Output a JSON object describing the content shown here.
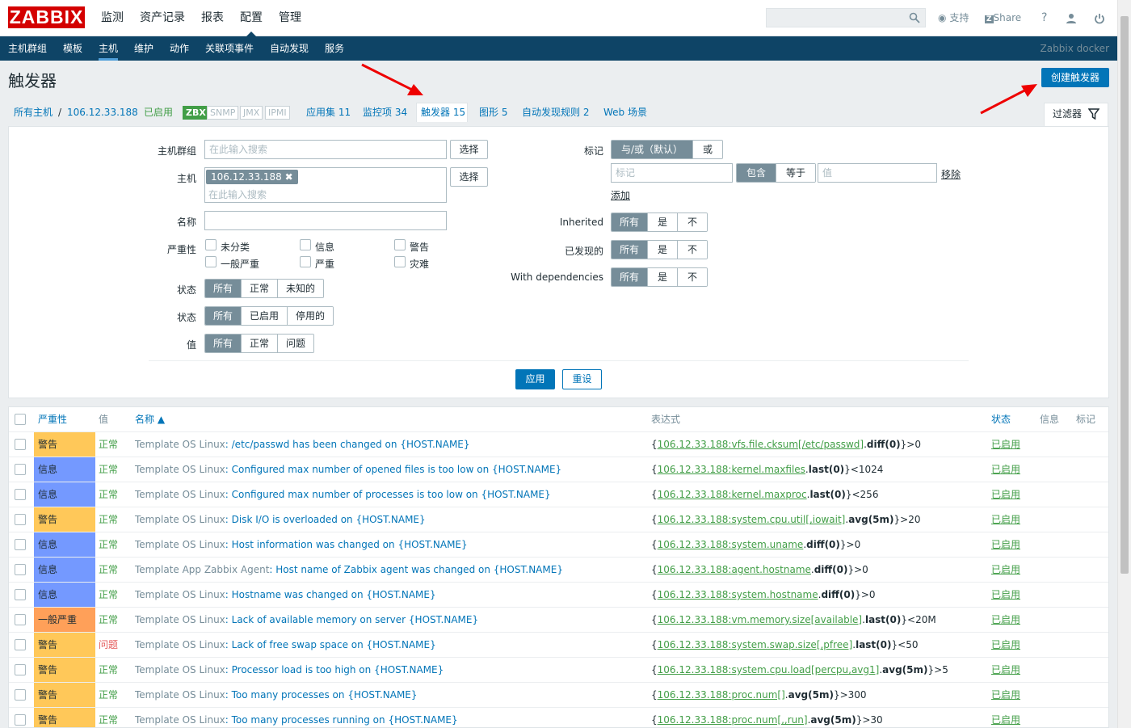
{
  "logo": "ZABBIX",
  "main_menu": [
    "监测",
    "资产记录",
    "报表",
    "配置",
    "管理"
  ],
  "topright": {
    "support": "支持",
    "share": "Share",
    "help": "?"
  },
  "sub_menu": [
    "主机群组",
    "模板",
    "主机",
    "维护",
    "动作",
    "关联项事件",
    "自动发现",
    "服务"
  ],
  "sub_right": "Zabbix docker",
  "page_title": "触发器",
  "create_button": "创建触发器",
  "breadcrumb": {
    "all_hosts": "所有主机",
    "sep": "/",
    "host": "106.12.33.188",
    "enabled": "已启用",
    "zbx": "ZBX",
    "snmp": "SNMP",
    "jmx": "JMX",
    "ipmi": "IPMI",
    "apps": "应用集 11",
    "items": "监控项 34",
    "triggers": "触发器 15",
    "graphs": "图形 5",
    "discovery": "自动发现规则 2",
    "web": "Web 场景"
  },
  "filter_tab": "过滤器",
  "filter": {
    "host_group_label": "主机群组",
    "host_group_placeholder": "在此输入搜索",
    "select": "选择",
    "host_label": "主机",
    "host_tag": "106.12.33.188",
    "host_placeholder": "在此输入搜索",
    "name_label": "名称",
    "severity_label": "严重性",
    "severities": [
      "未分类",
      "信息",
      "警告",
      "一般严重",
      "严重",
      "灾难"
    ],
    "state_label": "状态",
    "state_opts": [
      "所有",
      "正常",
      "未知的"
    ],
    "status_label": "状态",
    "status_opts": [
      "所有",
      "已启用",
      "停用的"
    ],
    "value_label": "值",
    "value_opts": [
      "所有",
      "正常",
      "问题"
    ],
    "tags_label": "标记",
    "tags_opts": [
      "与/或（默认）",
      "或"
    ],
    "tag_placeholder": "标记",
    "tag_ops": [
      "包含",
      "等于"
    ],
    "value_placeholder": "值",
    "remove": "移除",
    "add": "添加",
    "inherited_label": "Inherited",
    "discovered_label": "已发现的",
    "deps_label": "With dependencies",
    "yn_opts": [
      "所有",
      "是",
      "不"
    ],
    "apply": "应用",
    "reset": "重设"
  },
  "table": {
    "headers": {
      "severity": "严重性",
      "value": "值",
      "name": "名称 ▲",
      "expression": "表达式",
      "status": "状态",
      "info": "信息",
      "tags": "标记"
    },
    "rows": [
      {
        "sev": "警告",
        "cls": "warn",
        "val": "正常",
        "tmpl": "Template OS Linux",
        "name": "/etc/passwd has been changed on {HOST.NAME}",
        "ek": "106.12.33.188:vfs.file.cksum[/etc/passwd]",
        "ef": "diff(0)",
        "et": "}>0",
        "st": "已启用"
      },
      {
        "sev": "信息",
        "cls": "info",
        "val": "正常",
        "tmpl": "Template OS Linux",
        "name": "Configured max number of opened files is too low on {HOST.NAME}",
        "ek": "106.12.33.188:kernel.maxfiles",
        "ef": "last(0)",
        "et": "}<1024",
        "st": "已启用"
      },
      {
        "sev": "信息",
        "cls": "info",
        "val": "正常",
        "tmpl": "Template OS Linux",
        "name": "Configured max number of processes is too low on {HOST.NAME}",
        "ek": "106.12.33.188:kernel.maxproc",
        "ef": "last(0)",
        "et": "}<256",
        "st": "已启用"
      },
      {
        "sev": "警告",
        "cls": "warn",
        "val": "正常",
        "tmpl": "Template OS Linux",
        "name": "Disk I/O is overloaded on {HOST.NAME}",
        "ek": "106.12.33.188:system.cpu.util[,iowait]",
        "ef": "avg(5m)",
        "et": "}>20",
        "st": "已启用"
      },
      {
        "sev": "信息",
        "cls": "info",
        "val": "正常",
        "tmpl": "Template OS Linux",
        "name": "Host information was changed on {HOST.NAME}",
        "ek": "106.12.33.188:system.uname",
        "ef": "diff(0)",
        "et": "}>0",
        "st": "已启用"
      },
      {
        "sev": "信息",
        "cls": "info",
        "val": "正常",
        "tmpl": "Template App Zabbix Agent",
        "name": "Host name of Zabbix agent was changed on {HOST.NAME}",
        "ek": "106.12.33.188:agent.hostname",
        "ef": "diff(0)",
        "et": "}>0",
        "st": "已启用"
      },
      {
        "sev": "信息",
        "cls": "info",
        "val": "正常",
        "tmpl": "Template OS Linux",
        "name": "Hostname was changed on {HOST.NAME}",
        "ek": "106.12.33.188:system.hostname",
        "ef": "diff(0)",
        "et": "}>0",
        "st": "已启用"
      },
      {
        "sev": "一般严重",
        "cls": "avg",
        "val": "正常",
        "tmpl": "Template OS Linux",
        "name": "Lack of available memory on server {HOST.NAME}",
        "ek": "106.12.33.188:vm.memory.size[available]",
        "ef": "last(0)",
        "et": "}<20M",
        "st": "已启用"
      },
      {
        "sev": "警告",
        "cls": "warn",
        "val": "问题",
        "tmpl": "Template OS Linux",
        "name": "Lack of free swap space on {HOST.NAME}",
        "ek": "106.12.33.188:system.swap.size[,pfree]",
        "ef": "last(0)",
        "et": "}<50",
        "st": "已启用"
      },
      {
        "sev": "警告",
        "cls": "warn",
        "val": "正常",
        "tmpl": "Template OS Linux",
        "name": "Processor load is too high on {HOST.NAME}",
        "ek": "106.12.33.188:system.cpu.load[percpu,avg1]",
        "ef": "avg(5m)",
        "et": "}>5",
        "st": "已启用"
      },
      {
        "sev": "警告",
        "cls": "warn",
        "val": "正常",
        "tmpl": "Template OS Linux",
        "name": "Too many processes on {HOST.NAME}",
        "ek": "106.12.33.188:proc.num[]",
        "ef": "avg(5m)",
        "et": "}>300",
        "st": "已启用"
      },
      {
        "sev": "警告",
        "cls": "warn",
        "val": "正常",
        "tmpl": "Template OS Linux",
        "name": "Too many processes running on {HOST.NAME}",
        "ek": "106.12.33.188:proc.num[,,run]",
        "ef": "avg(5m)",
        "et": "}>30",
        "st": "已启用"
      }
    ]
  }
}
